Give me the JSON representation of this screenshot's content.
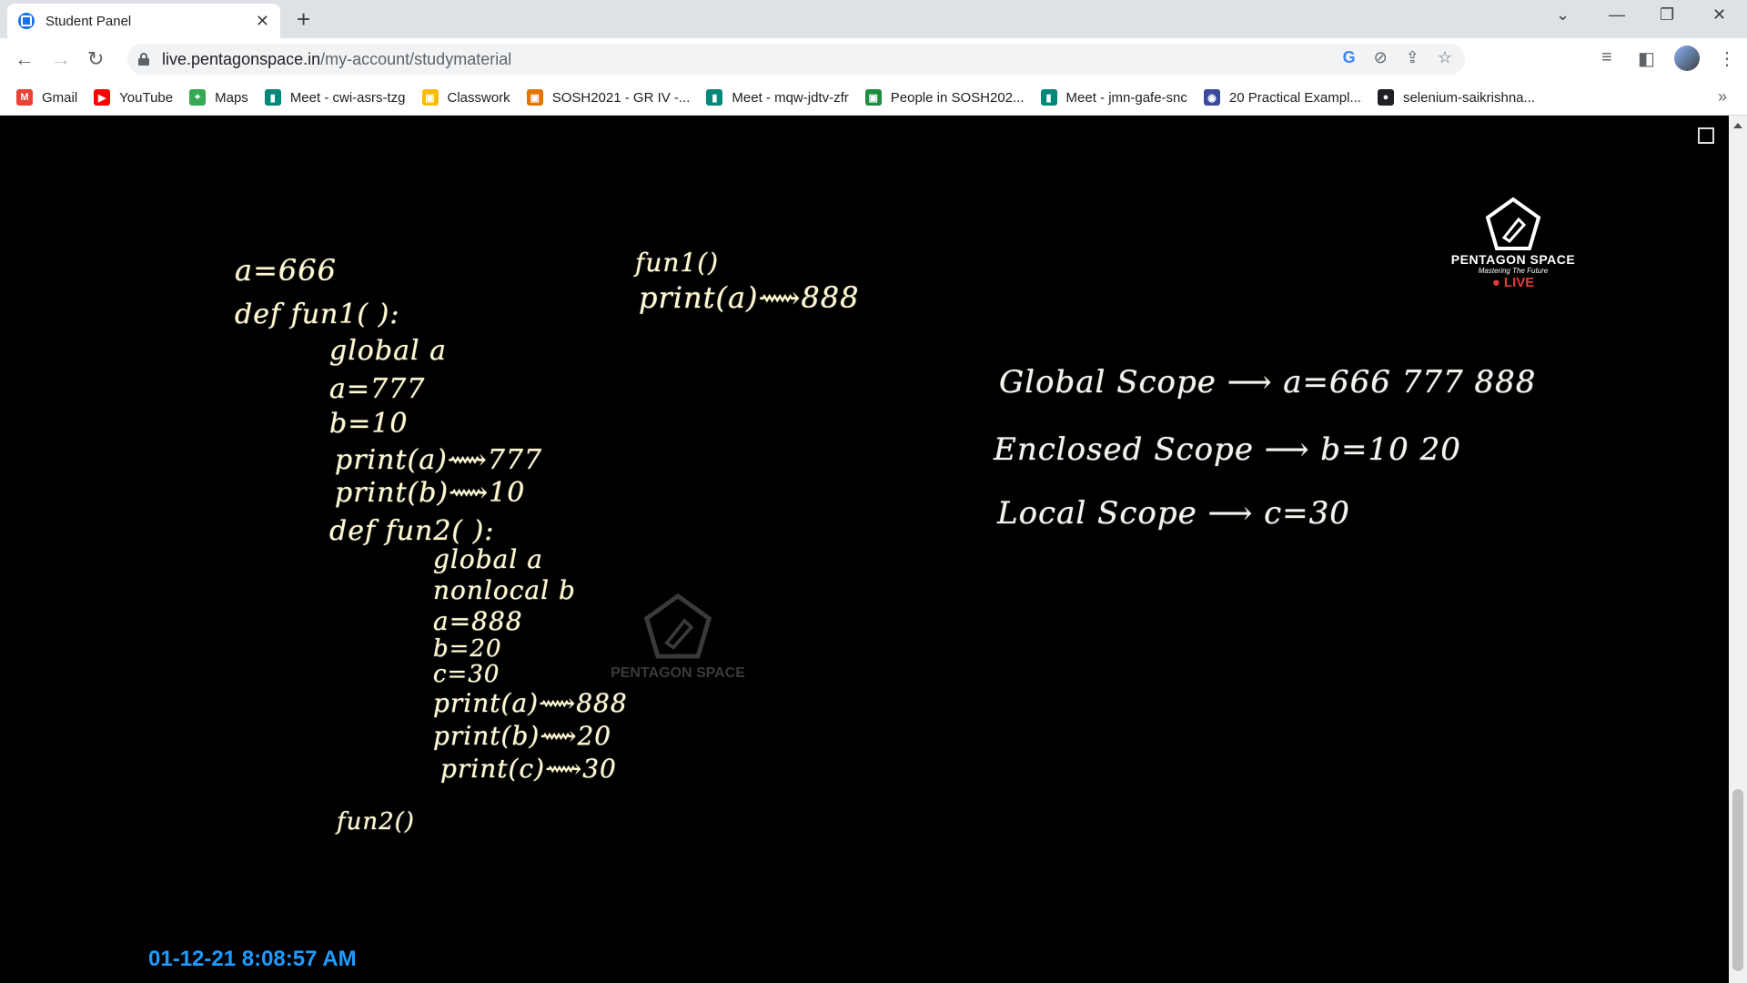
{
  "browser": {
    "tab_title": "Student Panel",
    "url_host": "live.pentagonspace.in",
    "url_path": "/my-account/studymaterial",
    "bookmarks": [
      {
        "label": "Gmail",
        "icon": "gmail-icon",
        "color": "#ea4335"
      },
      {
        "label": "YouTube",
        "icon": "youtube-icon",
        "color": "#ff0000"
      },
      {
        "label": "Maps",
        "icon": "maps-icon",
        "color": "#34a853"
      },
      {
        "label": "Meet - cwi-asrs-tzg",
        "icon": "meet-icon",
        "color": "#00897b"
      },
      {
        "label": "Classwork",
        "icon": "classroom-icon",
        "color": "#fbbc04"
      },
      {
        "label": "SOSH2021 - GR IV -...",
        "icon": "sosh-icon",
        "color": "#e37400"
      },
      {
        "label": "Meet - mqw-jdtv-zfr",
        "icon": "meet-icon",
        "color": "#00897b"
      },
      {
        "label": "People in SOSH202...",
        "icon": "classroom-icon",
        "color": "#1e8e3e"
      },
      {
        "label": "Meet - jmn-gafe-snc",
        "icon": "meet-icon",
        "color": "#00897b"
      },
      {
        "label": "20 Practical Exampl...",
        "icon": "shield-icon",
        "color": "#3c4a9e"
      },
      {
        "label": "selenium-saikrishna...",
        "icon": "github-icon",
        "color": "#202124"
      }
    ]
  },
  "board": {
    "left_lines": [
      "a=666",
      "def fun1( ):",
      "global a",
      "a=777",
      "b=10",
      "print(a)⟿777",
      "print(b)⟿10",
      "def fun2( ):",
      "global a",
      "nonlocal b",
      "a=888",
      "b=20",
      "c=30",
      "print(a)⟿888",
      "print(b)⟿20",
      "print(c)⟿30",
      "fun2()"
    ],
    "middle_lines": [
      "fun1()",
      "print(a)⟿888"
    ],
    "right_lines": [
      "Global Scope ⟶ a=666 777 888",
      "Enclosed Scope ⟶ b=10 20",
      "Local Scope ⟶ c=30"
    ]
  },
  "logo": {
    "name": "PENTAGON SPACE",
    "tagline": "Mastering The Future",
    "live": "● LIVE"
  },
  "watermark": {
    "name": "PENTAGON SPACE"
  },
  "timestamp": "01-12-21 8:08:57 AM"
}
